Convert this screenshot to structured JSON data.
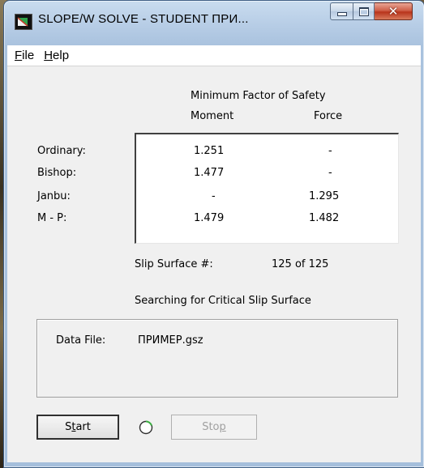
{
  "window": {
    "title": "SLOPE/W SOLVE - STUDENT ПРИ..."
  },
  "menu": [
    {
      "label": "File",
      "accel": "F",
      "rest": "ile"
    },
    {
      "label": "Help",
      "accel": "H",
      "rest": "elp"
    }
  ],
  "results": {
    "heading": "Minimum Factor of Safety",
    "col_moment": "Moment",
    "col_force": "Force",
    "rows": [
      {
        "method": "Ordinary:",
        "moment": "1.251",
        "force": "-"
      },
      {
        "method": "Bishop:",
        "moment": "1.477",
        "force": "-"
      },
      {
        "method": "Janbu:",
        "moment": "-",
        "force": "1.295"
      },
      {
        "method": "M - P:",
        "moment": "1.479",
        "force": "1.482"
      }
    ]
  },
  "slip": {
    "label": "Slip Surface #:",
    "value": "125 of 125"
  },
  "status": "Searching for Critical Slip Surface",
  "data_file": {
    "label": "Data File:",
    "value": "ПРИМЕР.gsz"
  },
  "buttons": {
    "start": {
      "pre": "S",
      "accel": "t",
      "post": "art"
    },
    "stop": {
      "pre": "Sto",
      "accel": "p",
      "post": ""
    }
  },
  "colors": {
    "accent_close": "#c8452c",
    "titlebar": "#b7cde6"
  }
}
